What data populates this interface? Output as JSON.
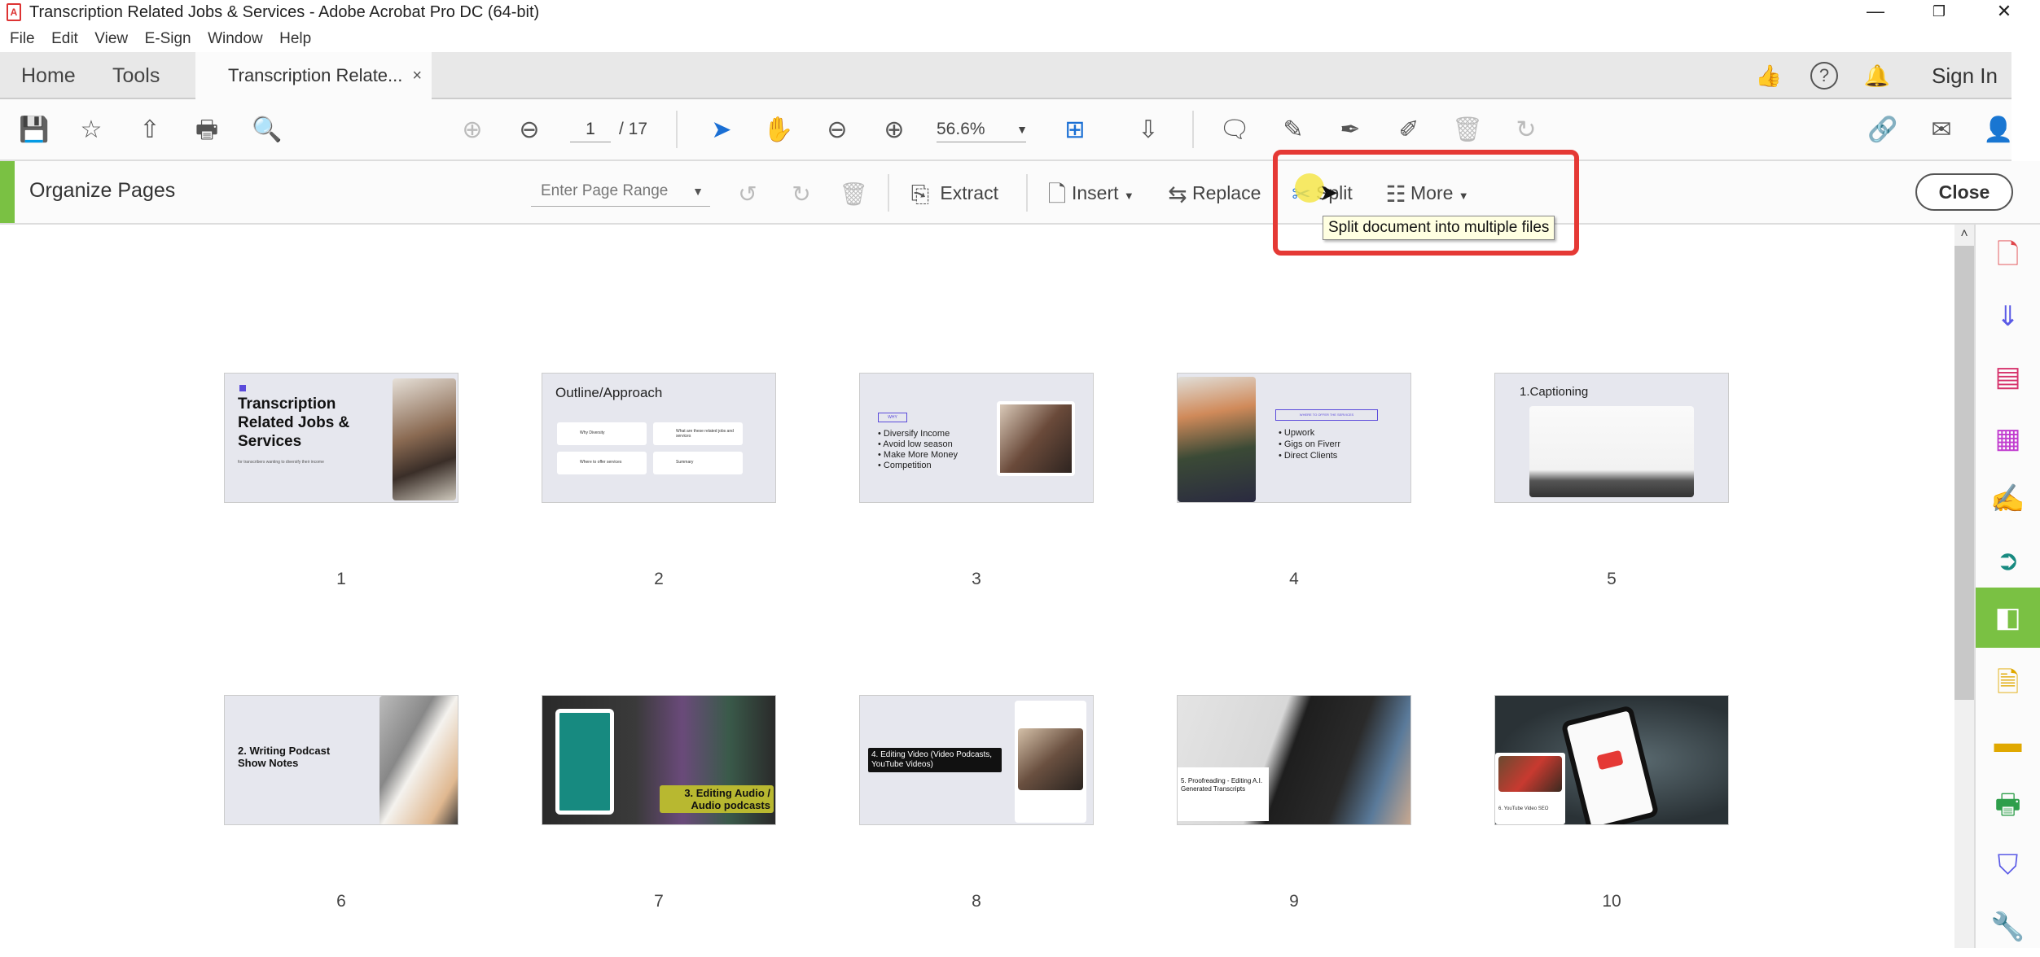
{
  "window": {
    "title": "Transcription Related Jobs & Services - Adobe Acrobat Pro DC (64-bit)",
    "app_icon": "pdf-icon",
    "controls": [
      "minimize",
      "restore",
      "close"
    ]
  },
  "menu": [
    "File",
    "Edit",
    "View",
    "E-Sign",
    "Window",
    "Help"
  ],
  "tabs": {
    "home": "Home",
    "tools": "Tools",
    "document": "Transcription Relate...",
    "close_glyph": "×"
  },
  "header_right": {
    "feedback_icon": "feedback-thumbs-icon",
    "help_icon": "help-icon",
    "bell_icon": "notification-bell-icon",
    "sign_in": "Sign In"
  },
  "toolbar": {
    "page_current": "1",
    "page_total": "/ 17",
    "zoom": "56.6%",
    "icons": [
      "save",
      "bookmark-star",
      "upload-cloud",
      "print",
      "search-zoom",
      "page-up",
      "page-down",
      "select-pointer",
      "hand",
      "zoom-out",
      "zoom-in",
      "fit-page",
      "scroll-mode",
      "comment",
      "highlight",
      "draw",
      "stamp-edit",
      "delete",
      "rotate",
      "share-link",
      "email",
      "add-user"
    ]
  },
  "organize": {
    "title": "Organize Pages",
    "page_range_placeholder": "Enter Page Range",
    "extract": "Extract",
    "insert": "Insert",
    "replace": "Replace",
    "split": "Split",
    "more": "More",
    "close": "Close",
    "tooltip": "Split document into multiple files"
  },
  "pages": [
    {
      "num": "1",
      "title": "Transcription Related Jobs & Services",
      "subtitle": "for transcribers wanting to diversify their income"
    },
    {
      "num": "2",
      "title": "Outline/Approach",
      "cards": [
        "Why Diversity",
        "What are these related jobs and services",
        "Where to offer services",
        "Summary"
      ]
    },
    {
      "num": "3",
      "label": "WHY",
      "bullets": [
        "Diversify Income",
        "Avoid low season",
        "Make More Money",
        "Competition"
      ]
    },
    {
      "num": "4",
      "label": "WHERE TO OFFER THE SERVICES",
      "bullets": [
        "Upwork",
        "Gigs on Fiverr",
        "Direct Clients"
      ]
    },
    {
      "num": "5",
      "title": "1.Captioning"
    },
    {
      "num": "6",
      "title": "2. Writing Podcast Show Notes"
    },
    {
      "num": "7",
      "title": "3. Editing Audio / Audio podcasts"
    },
    {
      "num": "8",
      "title": "4. Editing Video (Video Podcasts, YouTube Videos)"
    },
    {
      "num": "9",
      "title": "5. Proofreading - Editing A.I. Generated Transcripts"
    },
    {
      "num": "10",
      "title": "6. YouTube Video SEO"
    }
  ],
  "right_rail": [
    "create-pdf",
    "export-pdf",
    "organize",
    "edit-pdf",
    "fill-sign",
    "send-review",
    "organize-pages-active",
    "comment-file",
    "comment",
    "print-production",
    "protect",
    "more-tools"
  ],
  "colors": {
    "accent_green": "#7ac143",
    "highlight_red": "#e53935",
    "tooltip_bg": "#ffffe1"
  }
}
